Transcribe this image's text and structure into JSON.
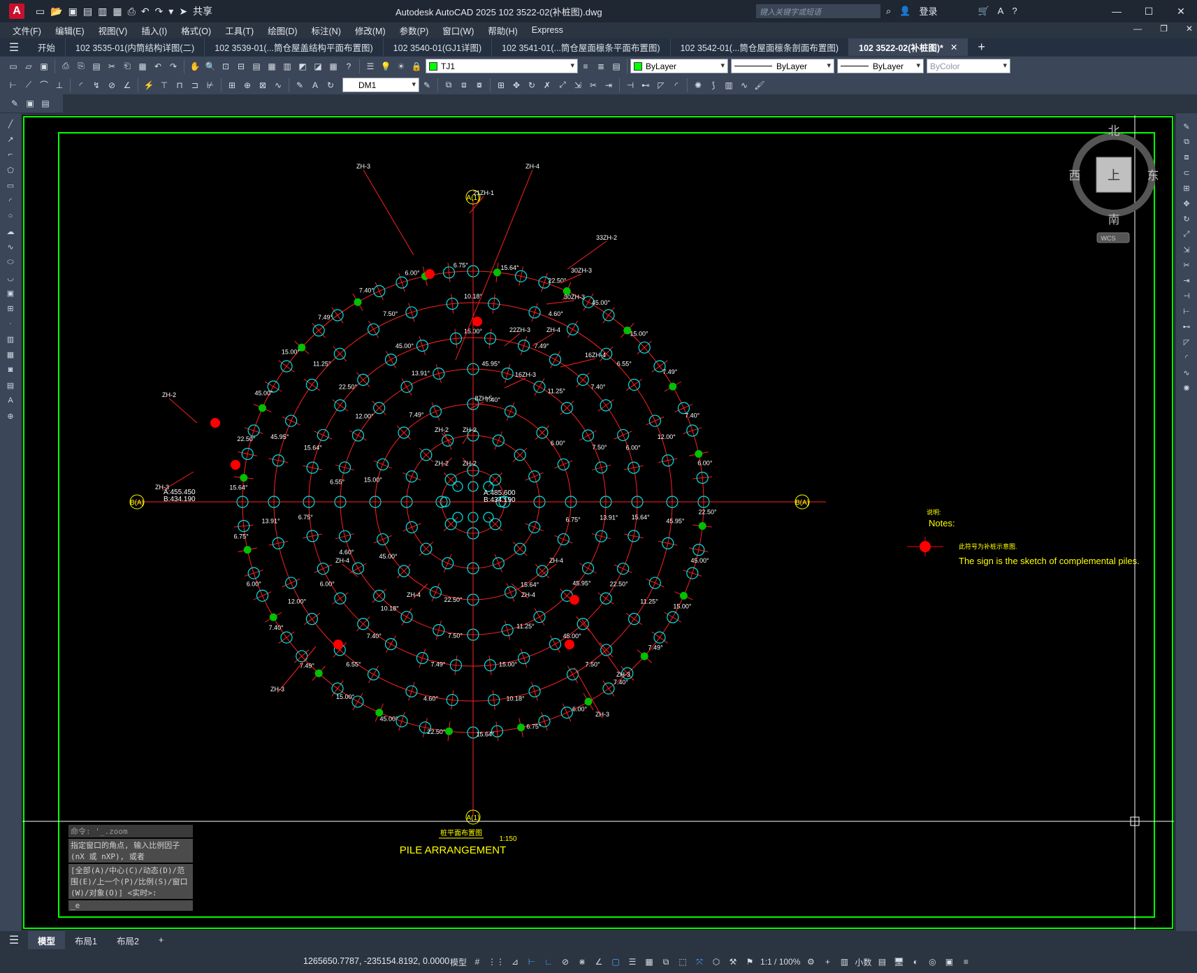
{
  "title": "Autodesk AutoCAD 2025    102 3522-02(补桩图).dwg",
  "app_logo": "A",
  "search_placeholder": "键入关键字或短语",
  "share_label": "共享",
  "login_label": "登录",
  "menu": [
    "文件(F)",
    "编辑(E)",
    "视图(V)",
    "插入(I)",
    "格式(O)",
    "工具(T)",
    "绘图(D)",
    "标注(N)",
    "修改(M)",
    "参数(P)",
    "窗口(W)",
    "帮助(H)",
    "Express"
  ],
  "doc_tabs": [
    {
      "label": "开始"
    },
    {
      "label": "102 3535-01(内筒结构详图(二)"
    },
    {
      "label": "102 3539-01(...筒仓屋盖结构平面布置图)"
    },
    {
      "label": "102 3540-01(GJ1详图)"
    },
    {
      "label": "102 3541-01(...筒仓屋面檩条平面布置图)"
    },
    {
      "label": "102 3542-01(...筒仓屋面檩条剖面布置图)"
    },
    {
      "label": "102 3522-02(补桩图)*"
    }
  ],
  "toolbar": {
    "layer": "TJ1",
    "color": "ByLayer",
    "linetype": "ByLayer",
    "lineweight": "ByLayer",
    "plotstyle": "ByColor",
    "dimstyle": "DM1"
  },
  "colors": {
    "frame": "#00ff00",
    "ring": "#ff2020",
    "pile": "#00e5e5",
    "text": "#ffffff",
    "yellow": "#ffff00",
    "mark": "#ff0000",
    "green_pile": "#00c000"
  },
  "drawing": {
    "axis_top": "A(1)",
    "axis_bottom": "A(1)",
    "axis_left": "B(A)",
    "axis_right": "B(A)",
    "coord_a": "A:455.450",
    "coord_b": "B:434.190",
    "center_a": "A:485.600",
    "center_b": "B:434.190",
    "labels": [
      "ZH-3",
      "ZH-4",
      "21ZH-1",
      "33ZH-2",
      "30ZH-3",
      "30ZH-3",
      "ZH-2",
      "ZH-3",
      "16ZH-4",
      "16ZH-3",
      "8ZH-5",
      "22ZH-3",
      "ZH-4",
      "ZH-2",
      "ZH-2",
      "ZH-2",
      "ZH-2",
      "ZH-3",
      "ZH-3",
      "ZH-3",
      "ZH-4",
      "ZH-4",
      "ZH-4",
      "ZH-4"
    ],
    "angles": [
      "6.00°",
      "12.00°",
      "6.75°",
      "13.91°",
      "15.64°",
      "45.95°",
      "22.50°",
      "11.25°",
      "45.00°",
      "7.50°",
      "15.00°",
      "10.18°",
      "7.49°",
      "4.60°",
      "7.40°",
      "6.55°"
    ],
    "notes_title_cn": "说明:",
    "notes_title": "Notes:",
    "notes_text_cn": "此符号为补桩示意图.",
    "notes_text": "The sign is the sketch of complemental piles.",
    "plan_title_cn": "桩平面布置图",
    "plan_scale": "1:150",
    "plan_title": "PILE ARRANGEMENT"
  },
  "viewcube": {
    "north": "北",
    "south": "南",
    "east": "东",
    "west": "西",
    "face": "上",
    "wcs": "WCS"
  },
  "command": {
    "line1": "命令: '_.zoom",
    "line2": "指定窗口的角点, 输入比例因子 (nX 或 nXP), 或者",
    "line3": "[全部(A)/中心(C)/动态(D)/范围(E)/上一个(P)/比例(S)/窗口(W)/对象(O)] <实时>:",
    "line4": "_e"
  },
  "layout_tabs": [
    "模型",
    "布局1",
    "布局2"
  ],
  "status": {
    "coords": "1265650.7787, -235154.8192, 0.0000",
    "model": "模型",
    "scale": "1:1 / 100%",
    "units": "小数"
  }
}
